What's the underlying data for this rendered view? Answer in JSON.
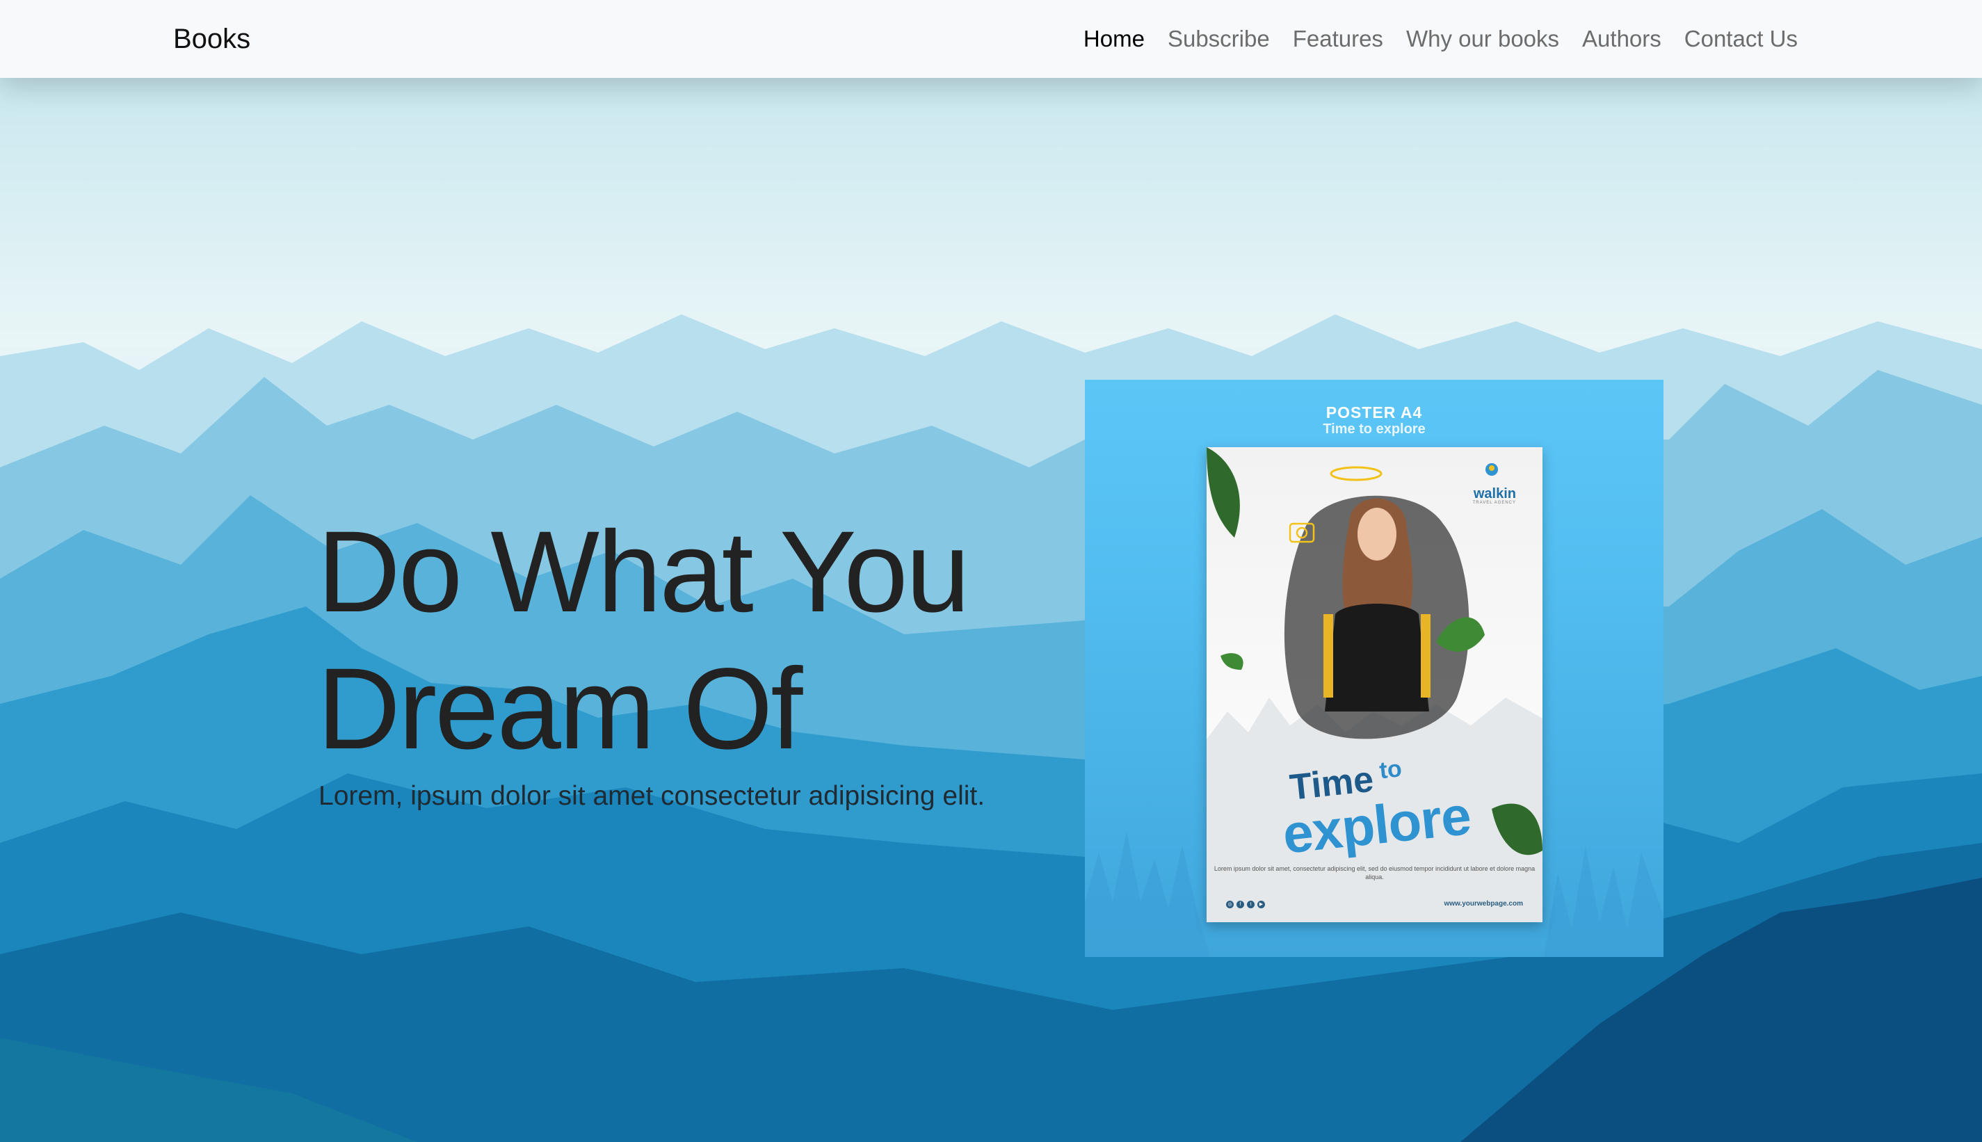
{
  "navbar": {
    "brand": "Books",
    "items": [
      {
        "label": "Home",
        "active": true
      },
      {
        "label": "Subscribe",
        "active": false
      },
      {
        "label": "Features",
        "active": false
      },
      {
        "label": "Why our books",
        "active": false
      },
      {
        "label": "Authors",
        "active": false
      },
      {
        "label": "Contact Us",
        "active": false
      }
    ]
  },
  "hero": {
    "headline": "Do What You Dream Of",
    "subtext": "Lorem, ipsum dolor sit amet consectetur adipisicing elit.",
    "background_image": "blue mountain range"
  },
  "poster_panel": {
    "title": "POSTER A4",
    "subtitle": "Time to explore",
    "poster": {
      "logo": "walkin",
      "logo_tagline": "TRAVEL AGENCY",
      "heading_small": "Time",
      "heading_to": "to",
      "heading_large": "explore",
      "body": "Lorem ipsum dolor sit amet, consectetur adipiscing elit, sed do eiusmod tempor incididunt ut labore et dolore magna aliqua.",
      "url": "www.yourwebpage.com",
      "social_icons": [
        "instagram-icon",
        "facebook-icon",
        "twitter-icon",
        "youtube-icon"
      ]
    }
  },
  "colors": {
    "navbar_bg": "#f8f9fa",
    "active_link": "#000000",
    "inactive_link": "#6c6c6c",
    "panel_blue": "#5cc6f7",
    "headline": "#222222"
  }
}
